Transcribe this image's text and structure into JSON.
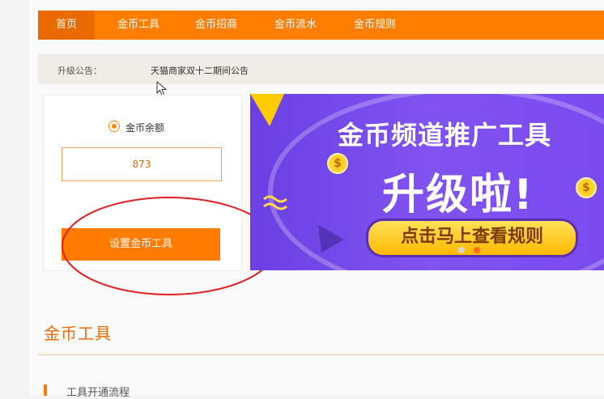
{
  "nav": {
    "items": [
      "首页",
      "金币工具",
      "金币招商",
      "金币流水",
      "金币规则"
    ],
    "active_index": 0
  },
  "notice": {
    "label": "升级公告：",
    "text": "天猫商家双十二期间公告"
  },
  "balance": {
    "radio_label": "金币余额",
    "amount": "873",
    "button_label": "设置金币工具"
  },
  "banner": {
    "title": "金币频道推广工具",
    "big_text": "升级啦!",
    "pill_text": "点击马上查看规则",
    "coin_symbol": "$"
  },
  "section": {
    "title": "金币工具",
    "subsection": "工具开通流程"
  },
  "colors": {
    "brand_orange": "#ff7e00",
    "banner_purple": "#7a4bef",
    "annotation_red": "#e02020"
  }
}
